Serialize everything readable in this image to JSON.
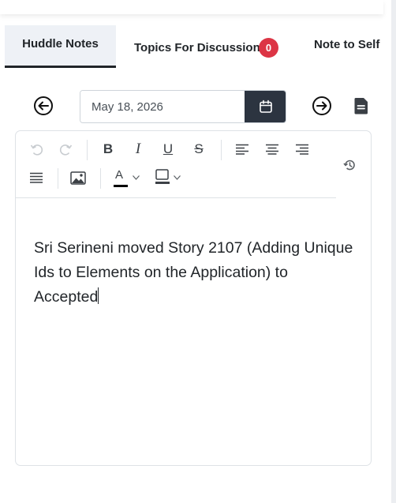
{
  "tabs": {
    "huddle_notes": "Huddle Notes",
    "topics_for_discussion": "Topics For Discussion",
    "topics_count": "0",
    "note_to_self": "Note to Self"
  },
  "date_nav": {
    "date_value": "May 18, 2026",
    "prev_icon": "arrow-left-circle-icon",
    "next_icon": "arrow-right-circle-icon",
    "calendar_icon": "calendar-icon",
    "document_icon": "document-icon"
  },
  "editor": {
    "toolbar_icons": [
      "undo-icon",
      "redo-icon",
      "bold-icon",
      "italic-icon",
      "underline-icon",
      "strikethrough-icon",
      "align-left-icon",
      "align-center-icon",
      "align-right-icon",
      "justify-icon",
      "image-icon",
      "font-color-icon",
      "background-color-icon",
      "history-icon"
    ],
    "bold_glyph": "B",
    "italic_glyph": "I",
    "underline_glyph": "U",
    "strike_glyph": "S",
    "font_color_glyph": "A",
    "content": "Sri Serineni moved Story 2107 (Adding Unique Ids to Elements on the Application) to Accepted"
  },
  "colors": {
    "active_tab_bg": "#eef1f6",
    "badge": "#dc3545",
    "calendar_button": "#2c3440"
  }
}
